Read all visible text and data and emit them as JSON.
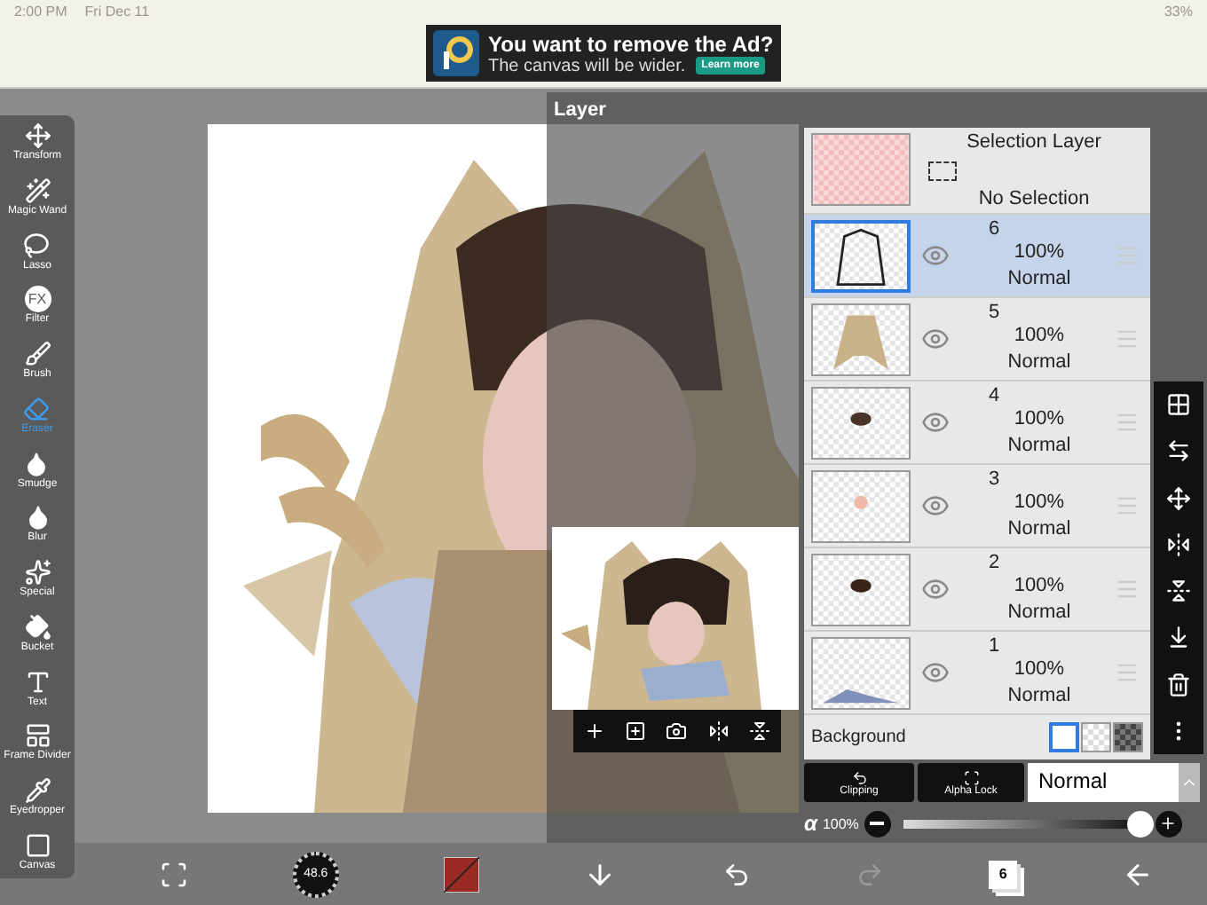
{
  "status_bar": {
    "time": "2:00 PM",
    "date": "Fri Dec 11",
    "battery": "33%"
  },
  "ad_banner": {
    "title": "You want to remove the Ad?",
    "subtitle": "The canvas will be wider.",
    "button": "Learn more"
  },
  "tools": [
    {
      "label": "Transform",
      "selected": false
    },
    {
      "label": "Magic Wand",
      "selected": false
    },
    {
      "label": "Lasso",
      "selected": false
    },
    {
      "label": "Filter",
      "glyph": "FX",
      "selected": false
    },
    {
      "label": "Brush",
      "selected": false
    },
    {
      "label": "Eraser",
      "selected": true
    },
    {
      "label": "Smudge",
      "selected": false
    },
    {
      "label": "Blur",
      "selected": false
    },
    {
      "label": "Special",
      "selected": false
    },
    {
      "label": "Bucket",
      "selected": false
    },
    {
      "label": "Text",
      "selected": false
    },
    {
      "label": "Frame Divider",
      "selected": false
    },
    {
      "label": "Eyedropper",
      "selected": false
    },
    {
      "label": "Canvas",
      "selected": false
    }
  ],
  "layer_panel": {
    "title": "Layer",
    "selection_layer": {
      "name": "Selection Layer",
      "status": "No Selection"
    },
    "layers": [
      {
        "number": "6",
        "opacity": "100%",
        "blend": "Normal",
        "visible": true,
        "selected": true
      },
      {
        "number": "5",
        "opacity": "100%",
        "blend": "Normal",
        "visible": true,
        "selected": false
      },
      {
        "number": "4",
        "opacity": "100%",
        "blend": "Normal",
        "visible": true,
        "selected": false
      },
      {
        "number": "3",
        "opacity": "100%",
        "blend": "Normal",
        "visible": true,
        "selected": false
      },
      {
        "number": "2",
        "opacity": "100%",
        "blend": "Normal",
        "visible": true,
        "selected": false
      },
      {
        "number": "1",
        "opacity": "100%",
        "blend": "Normal",
        "visible": true,
        "selected": false
      }
    ],
    "background": {
      "label": "Background",
      "options": [
        {
          "kind": "white",
          "selected": true
        },
        {
          "kind": "transparent",
          "selected": false
        },
        {
          "kind": "dark",
          "selected": false
        }
      ]
    },
    "clipping": "Clipping",
    "alpha_lock": "Alpha Lock",
    "blend_mode": "Normal",
    "alpha": {
      "symbol": "α",
      "reading": "100%",
      "level": 0.96
    }
  },
  "bottom_bar": {
    "brush_size": "48.6",
    "layer_count": "6",
    "redo_disabled": true
  }
}
